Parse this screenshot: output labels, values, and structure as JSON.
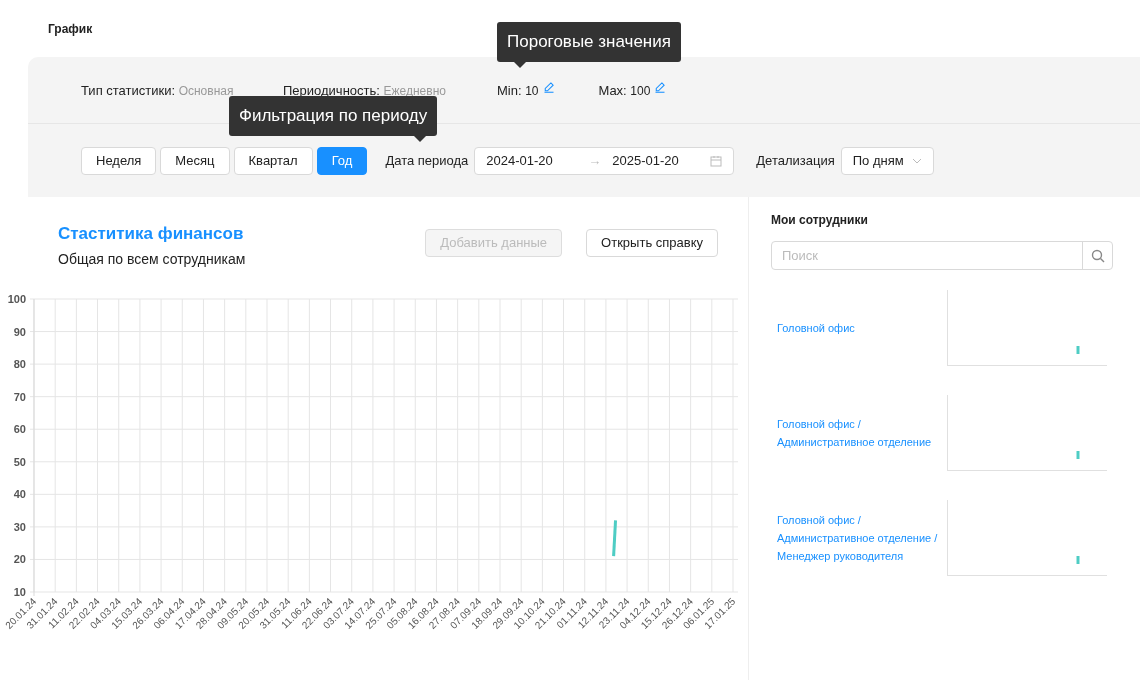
{
  "page_title": "График",
  "tooltips": [
    {
      "text": "Пороговые значения"
    },
    {
      "text": "Фильтрация по периоду"
    }
  ],
  "stats": {
    "type_label": "Тип статистики:",
    "type_value": "Основная",
    "period_label": "Периодичность:",
    "period_value": "Ежедневно",
    "min_label": "Min:",
    "min_value": "10",
    "max_label": "Max:",
    "max_value": "100"
  },
  "period_buttons": [
    {
      "label": "Неделя",
      "selected": false
    },
    {
      "label": "Месяц",
      "selected": false
    },
    {
      "label": "Квартал",
      "selected": false
    },
    {
      "label": "Год",
      "selected": true
    }
  ],
  "date_range": {
    "label": "Дата периода",
    "start": "2024-01-20",
    "separator": "→",
    "end": "2025-01-20"
  },
  "detail": {
    "label": "Детализация",
    "value": "По дням"
  },
  "chart_card": {
    "title": "Стаститика финансов",
    "subtitle": "Общая по всем сотрудникам",
    "buttons": [
      {
        "label": "Добавить данные",
        "disabled": true
      },
      {
        "label": "Открыть справку",
        "disabled": false
      }
    ],
    "chart_data": {
      "type": "line",
      "grid": true,
      "ylim": [
        10,
        100
      ],
      "yticks": [
        10,
        20,
        30,
        40,
        50,
        60,
        70,
        80,
        90,
        100
      ],
      "categories": [
        "20.01.24",
        null,
        null,
        null,
        null,
        null,
        null,
        null,
        null,
        null,
        null,
        "31.01.24",
        null,
        null,
        null,
        null,
        null,
        null,
        null,
        null,
        null,
        null,
        "11.02.24",
        null,
        null,
        null,
        null,
        null,
        null,
        null,
        null,
        null,
        null,
        "22.02.24",
        null,
        null,
        null,
        null,
        null,
        null,
        null,
        null,
        null,
        null,
        "04.03.24",
        null,
        null,
        null,
        null,
        null,
        null,
        null,
        null,
        null,
        null,
        "15.03.24",
        null,
        null,
        null,
        null,
        null,
        null,
        null,
        null,
        null,
        null,
        "26.03.24",
        null,
        null,
        null,
        null,
        null,
        null,
        null,
        null,
        null,
        null,
        "06.04.24",
        null,
        null,
        null,
        null,
        null,
        null,
        null,
        null,
        null,
        null,
        "17.04.24",
        null,
        null,
        null,
        null,
        null,
        null,
        null,
        null,
        null,
        null,
        "28.04.24",
        null,
        null,
        null,
        null,
        null,
        null,
        null,
        null,
        null,
        null,
        "09.05.24",
        null,
        null,
        null,
        null,
        null,
        null,
        null,
        null,
        null,
        null,
        "20.05.24",
        null,
        null,
        null,
        null,
        null,
        null,
        null,
        null,
        null,
        null,
        "31.05.24",
        null,
        null,
        null,
        null,
        null,
        null,
        null,
        null,
        null,
        null,
        "11.06.24",
        null,
        null,
        null,
        null,
        null,
        null,
        null,
        null,
        null,
        null,
        "22.06.24",
        null,
        null,
        null,
        null,
        null,
        null,
        null,
        null,
        null,
        null,
        "03.07.24",
        null,
        null,
        null,
        null,
        null,
        null,
        null,
        null,
        null,
        null,
        "14.07.24",
        null,
        null,
        null,
        null,
        null,
        null,
        null,
        null,
        null,
        null,
        "25.07.24",
        null,
        null,
        null,
        null,
        null,
        null,
        null,
        null,
        null,
        null,
        "05.08.24",
        null,
        null,
        null,
        null,
        null,
        null,
        null,
        null,
        null,
        null,
        "16.08.24",
        null,
        null,
        null,
        null,
        null,
        null,
        null,
        null,
        null,
        null,
        "27.08.24",
        null,
        null,
        null,
        null,
        null,
        null,
        null,
        null,
        null,
        null,
        "07.09.24",
        null,
        null,
        null,
        null,
        null,
        null,
        null,
        null,
        null,
        null,
        "18.09.24",
        null,
        null,
        null,
        null,
        null,
        null,
        null,
        null,
        null,
        null,
        "29.09.24",
        null,
        null,
        null,
        null,
        null,
        null,
        null,
        null,
        null,
        null,
        "10.10.24",
        null,
        null,
        null,
        null,
        null,
        null,
        null,
        null,
        null,
        null,
        "21.10.24",
        null,
        null,
        null,
        null,
        null,
        null,
        null,
        null,
        null,
        null,
        "01.11.24",
        null,
        null,
        null,
        null,
        null,
        null,
        null,
        null,
        null,
        null,
        "12.11.24",
        null,
        null,
        null,
        null,
        null,
        null,
        null,
        null,
        null,
        null,
        "23.11.24",
        null,
        null,
        null,
        null,
        null,
        null,
        null,
        null,
        null,
        null,
        "04.12.24",
        null,
        null,
        null,
        null,
        null,
        null,
        null,
        null,
        null,
        null,
        "15.12.24",
        null,
        null,
        null,
        null,
        null,
        null,
        null,
        null,
        null,
        null,
        "26.12.24",
        null,
        null,
        null,
        null,
        null,
        null,
        null,
        null,
        null,
        null,
        "06.01.25",
        null,
        null,
        null,
        null,
        null,
        null,
        null,
        null,
        null,
        null,
        "17.01.25"
      ],
      "series": [
        {
          "color": "#4ecdc4",
          "values": [
            null,
            null,
            null,
            null,
            null,
            null,
            null,
            null,
            null,
            null,
            null,
            null,
            null,
            null,
            null,
            null,
            null,
            null,
            null,
            null,
            null,
            null,
            null,
            null,
            null,
            null,
            null,
            null,
            null,
            null,
            null,
            null,
            null,
            null,
            null,
            null,
            null,
            null,
            null,
            null,
            null,
            null,
            null,
            null,
            null,
            null,
            null,
            null,
            null,
            null,
            null,
            null,
            null,
            null,
            null,
            null,
            null,
            null,
            null,
            null,
            null,
            null,
            null,
            null,
            null,
            null,
            null,
            null,
            null,
            null,
            null,
            null,
            null,
            null,
            null,
            null,
            null,
            null,
            null,
            null,
            null,
            null,
            null,
            null,
            null,
            null,
            null,
            null,
            null,
            null,
            null,
            null,
            null,
            null,
            null,
            null,
            null,
            null,
            null,
            null,
            null,
            null,
            null,
            null,
            null,
            null,
            null,
            null,
            null,
            null,
            null,
            null,
            null,
            null,
            null,
            null,
            null,
            null,
            null,
            null,
            null,
            null,
            null,
            null,
            null,
            null,
            null,
            null,
            null,
            null,
            null,
            null,
            null,
            null,
            null,
            null,
            null,
            null,
            null,
            null,
            null,
            null,
            null,
            null,
            null,
            null,
            null,
            null,
            null,
            null,
            null,
            null,
            null,
            null,
            null,
            null,
            null,
            null,
            null,
            null,
            null,
            null,
            null,
            null,
            null,
            null,
            null,
            null,
            null,
            null,
            null,
            null,
            null,
            null,
            null,
            null,
            null,
            null,
            null,
            null,
            null,
            null,
            null,
            null,
            null,
            null,
            null,
            null,
            null,
            null,
            null,
            null,
            null,
            null,
            null,
            null,
            null,
            null,
            null,
            null,
            null,
            null,
            null,
            null,
            null,
            null,
            null,
            null,
            null,
            null,
            null,
            null,
            null,
            null,
            null,
            null,
            null,
            null,
            null,
            null,
            null,
            null,
            null,
            null,
            null,
            null,
            null,
            null,
            null,
            null,
            null,
            null,
            null,
            null,
            null,
            null,
            null,
            null,
            null,
            null,
            null,
            null,
            null,
            null,
            null,
            null,
            null,
            null,
            null,
            null,
            null,
            null,
            null,
            null,
            null,
            null,
            null,
            null,
            null,
            null,
            null,
            null,
            null,
            null,
            null,
            null,
            null,
            null,
            null,
            null,
            null,
            null,
            null,
            null,
            null,
            null,
            null,
            null,
            null,
            null,
            null,
            null,
            null,
            null,
            null,
            null,
            null,
            null,
            null,
            null,
            null,
            null,
            null,
            null,
            null,
            null,
            null,
            null,
            null,
            null,
            null,
            21,
            32,
            null,
            null,
            null,
            null,
            null,
            null,
            null,
            null,
            null,
            null,
            null,
            null,
            null,
            null,
            null,
            null,
            null,
            null,
            null,
            null,
            null,
            null,
            null,
            null,
            null,
            null,
            null,
            null,
            null,
            null,
            null,
            null,
            null,
            null,
            null,
            null,
            null,
            null,
            null,
            null,
            null,
            null,
            null,
            null,
            null,
            null,
            null,
            null,
            null,
            null,
            null,
            null,
            null,
            null,
            null,
            null,
            null,
            null,
            null,
            null,
            null
          ]
        }
      ]
    }
  },
  "employees": {
    "title": "Мои сотрудники",
    "search": {
      "placeholder": "Поиск"
    },
    "items": [
      {
        "label": "Головной офис"
      },
      {
        "label": "Головной офис / Административное отделение"
      },
      {
        "label": "Головной офис / Административное отделение / Менеджер руководителя"
      }
    ]
  }
}
